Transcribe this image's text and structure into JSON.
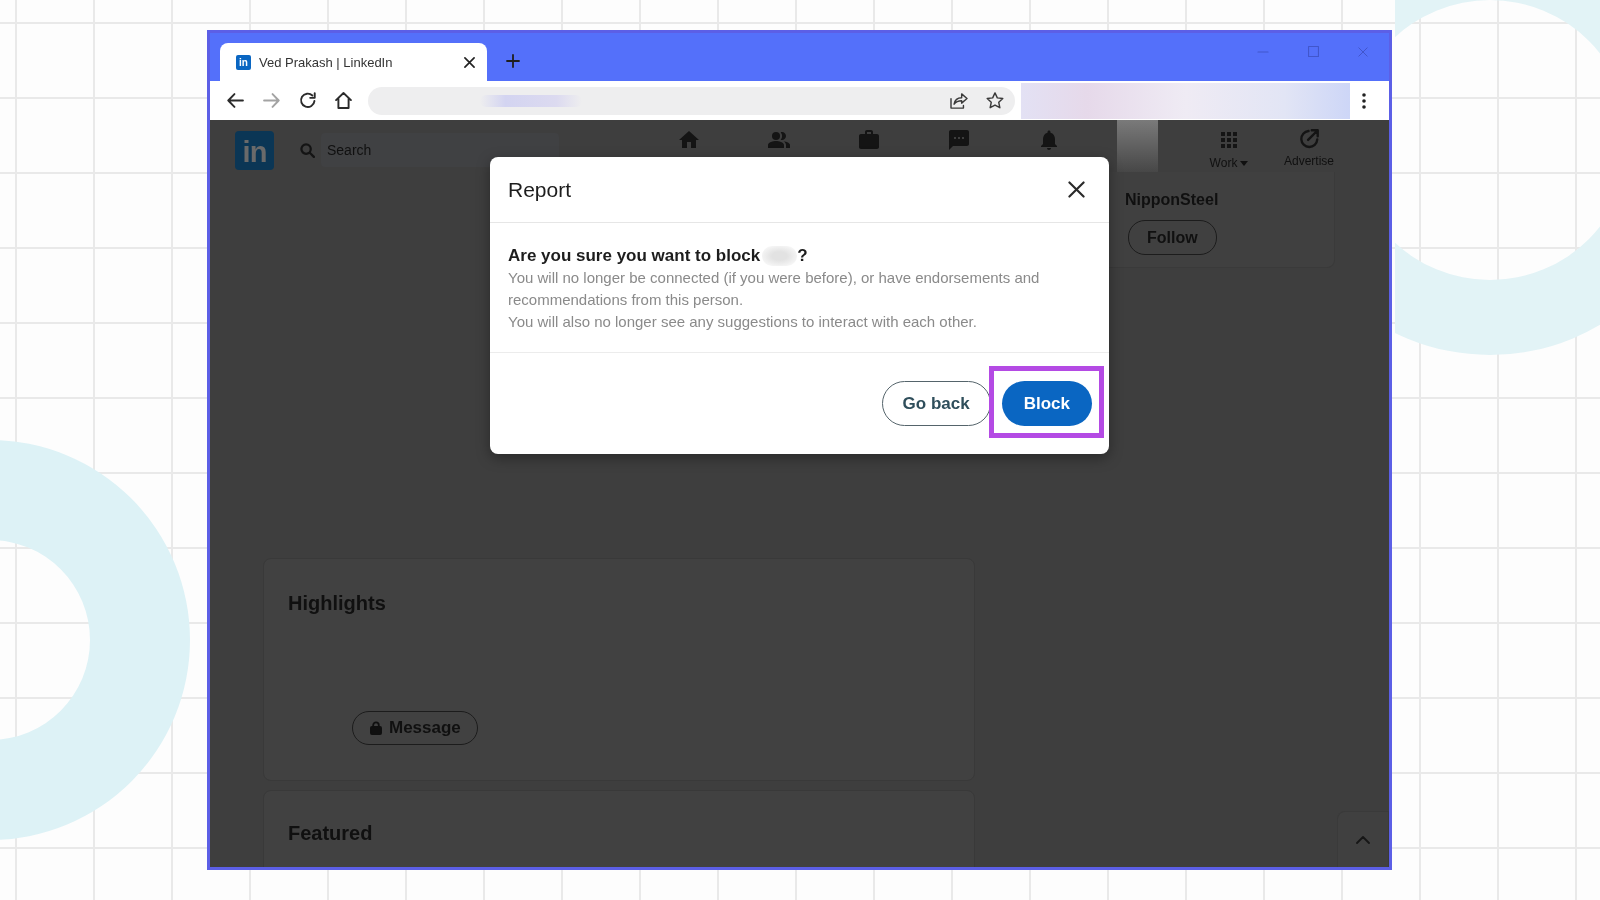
{
  "browser": {
    "tabs": [
      {
        "favicon": "in",
        "title": "Ved Prakash | LinkedIn",
        "selected": true
      }
    ],
    "toolbar": [
      {
        "kind": "back",
        "disabled": false
      },
      {
        "kind": "forward",
        "disabled": true
      },
      {
        "kind": "reload",
        "disabled": false
      },
      {
        "kind": "home",
        "disabled": false
      }
    ]
  },
  "linkedin": {
    "logo": "in",
    "search": {
      "placeholder": "Search"
    },
    "nav": [
      {
        "kind": "home"
      },
      {
        "kind": "network"
      },
      {
        "kind": "jobs"
      },
      {
        "kind": "messaging"
      },
      {
        "kind": "notifications"
      },
      {
        "kind": "me"
      },
      {
        "kind": "work",
        "label": "Work",
        "dropdown": true
      },
      {
        "kind": "advertise",
        "label": "Advertise",
        "dropdown": false
      }
    ],
    "aside": {
      "company": "NipponSteel",
      "follow_button": "Follow"
    },
    "highlights": {
      "title": "Highlights",
      "message_button": "Message"
    },
    "featured": {
      "title": "Featured"
    }
  },
  "dialog": {
    "title": "Report",
    "question_start": "Are you sure you want to block",
    "question_end": "?",
    "paragraphs": [
      "You will no longer be connected (if you were before), or have endorsements and recommendations from this person.",
      "You will also no longer see any suggestions to interact with each other."
    ],
    "buttons": [
      {
        "label": "Go back",
        "kind": "secondary",
        "highlighted": false
      },
      {
        "label": "Block",
        "kind": "primary",
        "highlighted": true
      }
    ]
  }
}
